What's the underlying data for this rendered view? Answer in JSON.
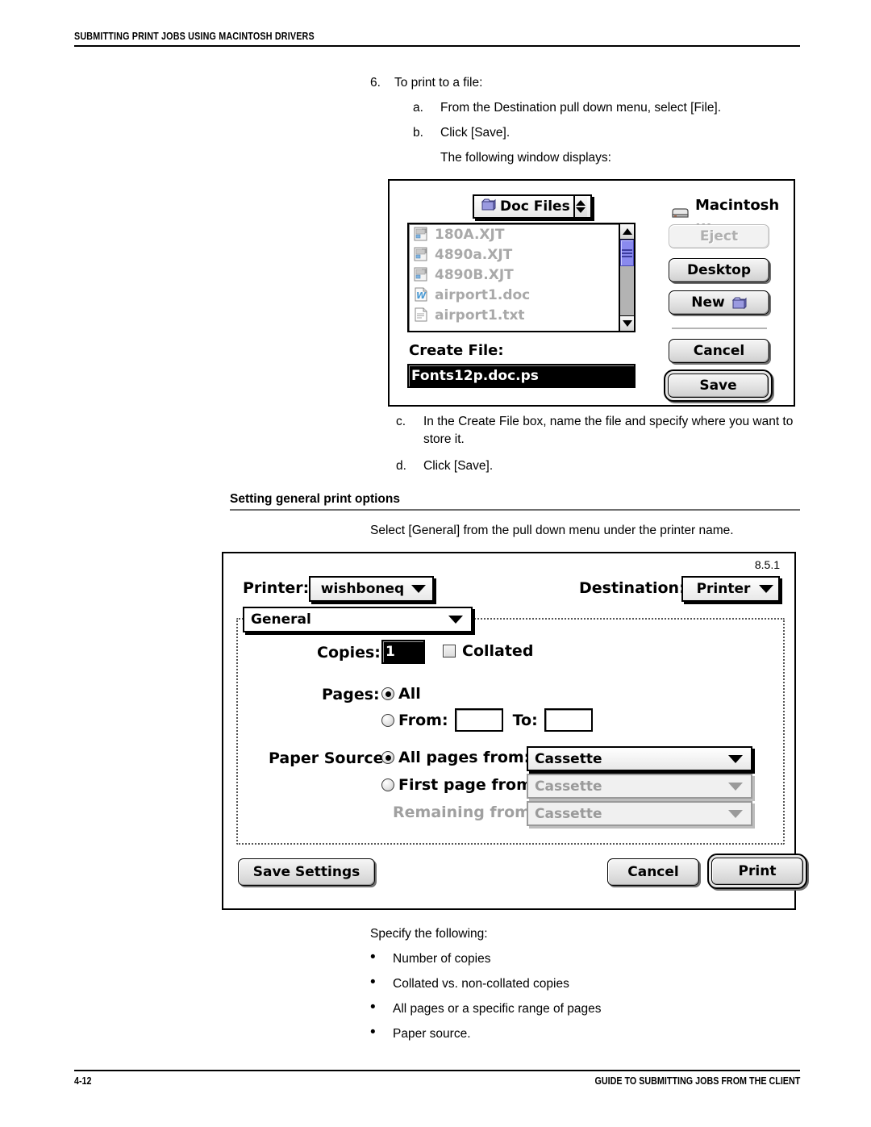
{
  "page": {
    "header": "SUBMITTING PRINT JOBS USING MACINTOSH DRIVERS",
    "footer_page_number": "4-12",
    "footer_guide": "GUIDE TO SUBMITTING JOBS FROM THE CLIENT"
  },
  "steps": {
    "step6_num": "6.",
    "step6_text": "To print to a file:",
    "a_label": "a.",
    "a_text": "From the Destination pull down menu, select [File].",
    "b_label": "b.",
    "b_text": "Click [Save].",
    "b_follow": "The following window displays:",
    "c_label": "c.",
    "c_text": "In the Create File box, name the file and specify where you want to store it.",
    "d_label": "d.",
    "d_text": "Click [Save]."
  },
  "section": {
    "heading": "Setting general print options",
    "intro": "Select [General] from the pull down menu under the printer name."
  },
  "save_dialog": {
    "location_popup": "Doc Files",
    "volume_name": "Macintosh ...",
    "files": [
      {
        "name": "180A.XJT",
        "icon": "xjt-document-icon"
      },
      {
        "name": "4890a.XJT",
        "icon": "xjt-document-icon"
      },
      {
        "name": "4890B.XJT",
        "icon": "xjt-document-icon"
      },
      {
        "name": "airport1.doc",
        "icon": "word-document-icon"
      },
      {
        "name": "airport1.txt",
        "icon": "text-document-icon"
      }
    ],
    "create_file_label": "Create File:",
    "file_name_value": "Fonts12p.doc.ps",
    "buttons": {
      "eject": "Eject",
      "desktop": "Desktop",
      "new": "New",
      "cancel": "Cancel",
      "save": "Save"
    },
    "eject_enabled": false,
    "save_is_default": true
  },
  "print_dialog": {
    "version": "8.5.1",
    "printer_label": "Printer:",
    "printer_value": "wishboneq",
    "destination_label": "Destination:",
    "destination_value": "Printer",
    "pane_value": "General",
    "copies_label": "Copies:",
    "copies_value": "1",
    "collated_label": "Collated",
    "collated_checked": false,
    "pages_label": "Pages:",
    "pages_all_label": "All",
    "pages_all_selected": true,
    "pages_from_label": "From:",
    "pages_from_value": "",
    "pages_to_label": "To:",
    "pages_to_value": "",
    "paper_source_label": "Paper Source:",
    "all_pages_from_label": "All pages from:",
    "all_pages_from_selected": true,
    "all_pages_from_value": "Cassette",
    "first_page_from_label": "First page from:",
    "first_page_from_selected": false,
    "first_page_from_value": "Cassette",
    "remaining_from_label": "Remaining from:",
    "remaining_from_value": "Cassette",
    "buttons": {
      "save_settings": "Save Settings",
      "cancel": "Cancel",
      "print": "Print"
    },
    "print_is_default": true
  },
  "specify": {
    "intro": "Specify the following:",
    "bullet_glyph": "•",
    "items": [
      "Number of copies",
      "Collated vs. non-collated copies",
      "All pages or a specific range of pages",
      "Paper source."
    ]
  }
}
